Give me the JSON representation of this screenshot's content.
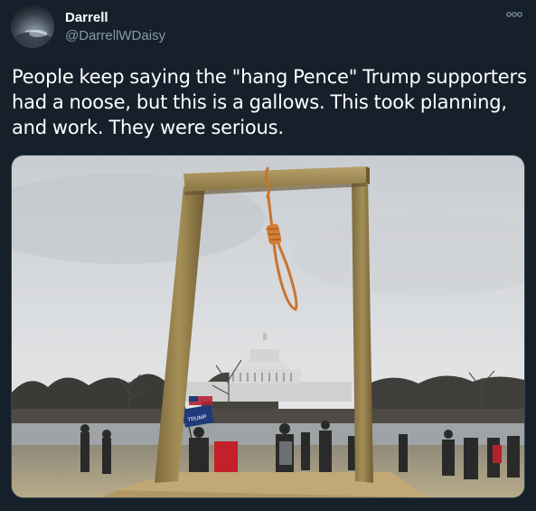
{
  "tweet": {
    "author": {
      "display_name": "Darrell",
      "handle": "@DarrellWDaisy",
      "avatar_icon": "profile-photo"
    },
    "more_icon": "more-options-icon",
    "text": "People keep saying the \"hang Pence\" Trump supporters had a noose, but this is a gallows. This took planning, and work. They were serious.",
    "media": {
      "type": "photo",
      "sign_text": "TRUMP"
    }
  },
  "colors": {
    "background": "#15202b",
    "text_primary": "#ffffff",
    "text_secondary": "#8899a6",
    "border": "#38444d"
  }
}
